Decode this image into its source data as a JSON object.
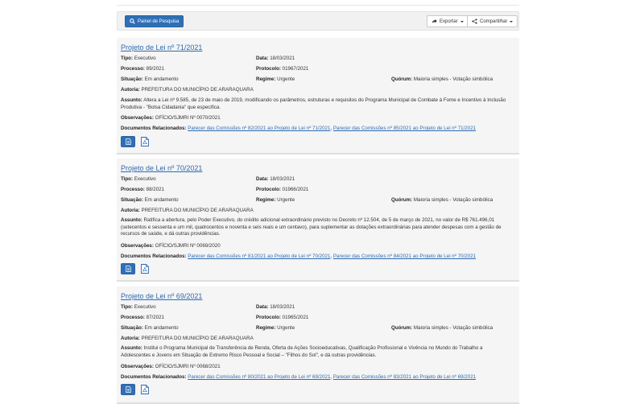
{
  "toolbar": {
    "search_label": "Painel de Pesquisa",
    "export_label": "Exportar",
    "share_label": "Compartilhar"
  },
  "labels": {
    "tipo": "Tipo:",
    "data": "Data:",
    "processo": "Processo:",
    "protocolo": "Protocolo:",
    "situacao": "Situação:",
    "regime": "Regime:",
    "quorum": "Quórum:",
    "autoria": "Autoria:",
    "assunto": "Assunto:",
    "observacoes": "Observações:",
    "documentos": "Documentos Relacionados:"
  },
  "cards": [
    {
      "title": "Projeto de Lei nº 71/2021",
      "tipo": "Executivo",
      "data": "18/03/2021",
      "processo": "89/2021",
      "protocolo": "01967/2021",
      "situacao": "Em andamento",
      "regime": "Urgente",
      "quorum": "Maioria simples - Votação simbólica",
      "autoria": "PREFEITURA DO MUNICÍPIO DE ARARAQUARA",
      "assunto": "Altera a Lei nº 9.585, de 23 de maio de 2019, modificando os parâmetros, estruturas e requisitos do Programa Municipal de Combate à Fome e Incentivo à Inclusão Produtiva - \"Bolsa Cidadania\" que especifica.",
      "observacoes": "OFÍCIO/SJMRI Nº 0070/2021",
      "docs": [
        "Parecer das Comissões nº 82/2021 ao Projeto de Lei nº 71/2021",
        "Parecer das Comissões nº 85/2021 ao Projeto de Lei nº 71/2021"
      ]
    },
    {
      "title": "Projeto de Lei nº 70/2021",
      "tipo": "Executivo",
      "data": "18/03/2021",
      "processo": "88/2021",
      "protocolo": "01966/2021",
      "situacao": "Em andamento",
      "regime": "Urgente",
      "quorum": "Maioria simples - Votação simbólica",
      "autoria": "PREFEITURA DO MUNICÍPIO DE ARARAQUARA",
      "assunto": "Ratifica a abertura, pelo Poder Executivo, do crédito adicional extraordinário previsto no Decreto nº 12.504, de 5 de março de 2021, no valor de R$ 761.496,01 (setecentos e sessenta e um mil, quatrocentos e noventa e seis reais e um centavo), para suplementar as dotações extraordinárias para atender despesas com a gestão de recursos de saúde, e dá outras providências.",
      "observacoes": "OFÍCIO/SJMRI Nº 0069/2020",
      "docs": [
        "Parecer das Comissões nº 81/2021 ao Projeto de Lei nº 70/2021",
        "Parecer das Comissões nº 84/2021 ao Projeto de Lei nº 70/2021"
      ]
    },
    {
      "title": "Projeto de Lei nº 69/2021",
      "tipo": "Executivo",
      "data": "18/03/2021",
      "processo": "87/2021",
      "protocolo": "01965/2021",
      "situacao": "Em andamento",
      "regime": "Urgente",
      "quorum": "Maioria simples - Votação simbólica",
      "autoria": "PREFEITURA DO MUNICÍPIO DE ARARAQUARA",
      "assunto": "Institui o Programa Municipal de Transferência de Renda, Oferta de Ações Socioeducativas, Qualificação Profissional e Vivência no Mundo do Trabalho a Adolescentes e Jovens em Situação de Extremo Risco Pessoal e Social – \"Filhos do Sol\", e dá outras providências.",
      "observacoes": "OFÍCIO/SJMRI Nº 0068/2021",
      "docs": [
        "Parecer das Comissões nº 80/2021 ao Projeto de Lei nº 69/2021",
        "Parecer das Comissões nº 83/2021 ao Projeto de Lei nº 69/2021"
      ]
    }
  ]
}
